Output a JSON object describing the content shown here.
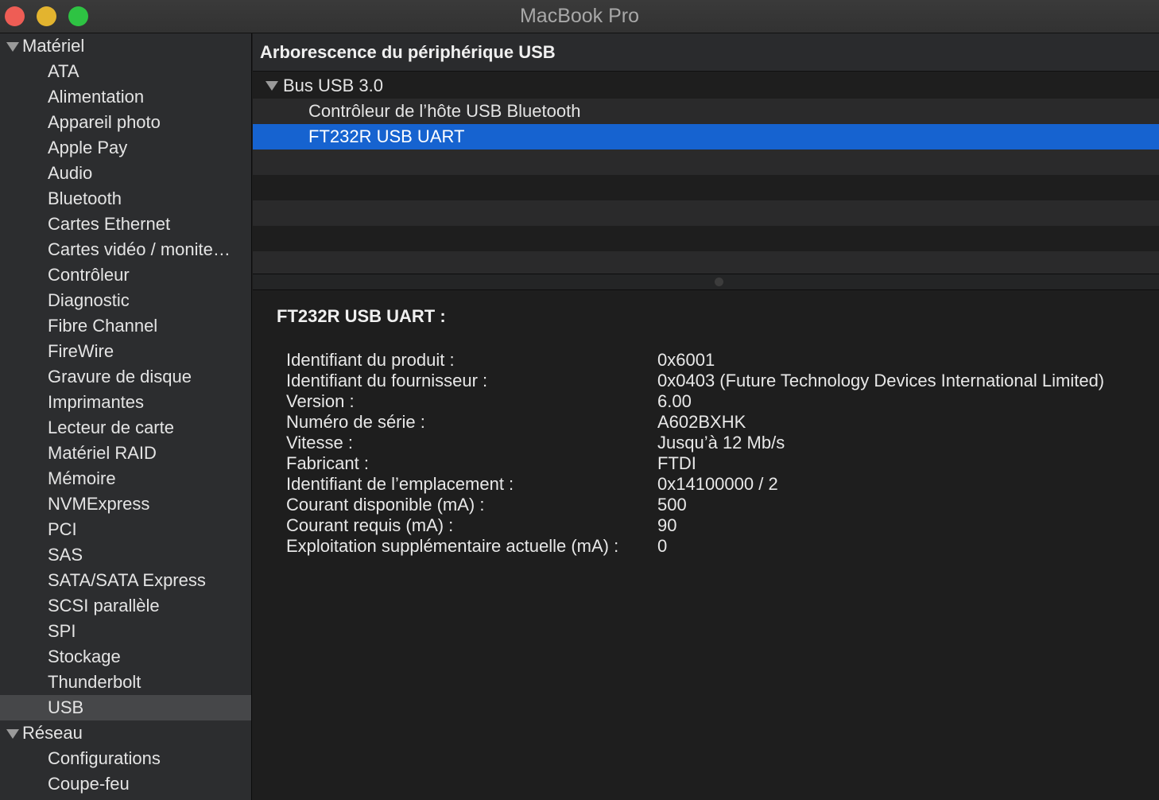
{
  "window": {
    "title": "MacBook Pro"
  },
  "sidebar": {
    "groups": [
      {
        "label": "Matériel",
        "items": [
          "ATA",
          "Alimentation",
          "Appareil photo",
          "Apple Pay",
          "Audio",
          "Bluetooth",
          "Cartes Ethernet",
          "Cartes vidéo / monite…",
          "Contrôleur",
          "Diagnostic",
          "Fibre Channel",
          "FireWire",
          "Gravure de disque",
          "Imprimantes",
          "Lecteur de carte",
          "Matériel RAID",
          "Mémoire",
          "NVMExpress",
          "PCI",
          "SAS",
          "SATA/SATA Express",
          "SCSI parallèle",
          "SPI",
          "Stockage",
          "Thunderbolt",
          "USB"
        ]
      },
      {
        "label": "Réseau",
        "items": [
          "Configurations",
          "Coupe-feu"
        ]
      }
    ],
    "selected": "USB"
  },
  "tree": {
    "header": "Arborescence du périphérique USB",
    "rows": [
      {
        "label": "Bus USB 3.0",
        "level": 0,
        "expanded": true
      },
      {
        "label": "Contrôleur de l’hôte USB Bluetooth",
        "level": 1
      },
      {
        "label": "FT232R USB UART",
        "level": 1,
        "selected": true
      }
    ]
  },
  "detail": {
    "title": "FT232R USB UART :",
    "properties": [
      {
        "key": "Identifiant du produit :",
        "value": "0x6001"
      },
      {
        "key": "Identifiant du fournisseur :",
        "value": "0x0403  (Future Technology Devices International Limited)"
      },
      {
        "key": "Version :",
        "value": "6.00"
      },
      {
        "key": "Numéro de série :",
        "value": "A602BXHK"
      },
      {
        "key": "Vitesse :",
        "value": "Jusqu’à 12 Mb/s"
      },
      {
        "key": "Fabricant :",
        "value": "FTDI"
      },
      {
        "key": "Identifiant de l’emplacement :",
        "value": "0x14100000 / 2"
      },
      {
        "key": "Courant disponible (mA) :",
        "value": "500"
      },
      {
        "key": "Courant requis (mA) :",
        "value": "90"
      },
      {
        "key": "Exploitation supplémentaire actuelle (mA) :",
        "value": "0"
      }
    ]
  },
  "colors": {
    "selection": "#1663d0",
    "sidebar_selected": "#464749",
    "close": "#ee5d55",
    "minimize": "#e3b42f",
    "zoom": "#2ec343"
  }
}
